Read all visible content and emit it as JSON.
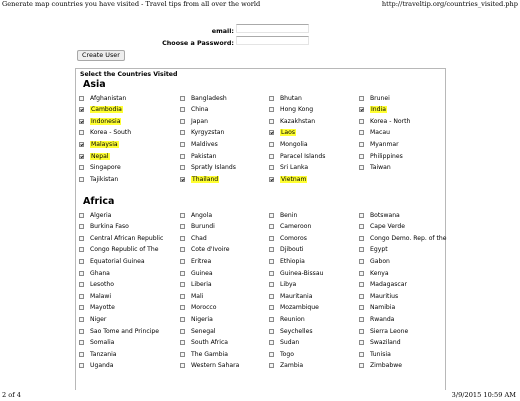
{
  "print_header": {
    "title": "Generate map countries you have visited - Travel tips from all over the world",
    "url": "http://traveltip.org/countries_visited.php"
  },
  "print_footer": {
    "page": "2 of 4",
    "timestamp": "3/9/2015 10:59 AM"
  },
  "form": {
    "email_label": "email:",
    "password_label": "Choose a Password:",
    "email_value": "",
    "password_value": "",
    "create_button": "Create User"
  },
  "countries": {
    "title": "Select the Countries Visited",
    "highlight_color": "#ffff33",
    "regions": [
      {
        "name": "Asia",
        "rows": [
          [
            {
              "name": "Afghanistan",
              "checked": false
            },
            {
              "name": "Bangladesh",
              "checked": false
            },
            {
              "name": "Bhutan",
              "checked": false
            },
            {
              "name": "Brunei",
              "checked": false
            }
          ],
          [
            {
              "name": "Cambodia",
              "checked": true
            },
            {
              "name": "China",
              "checked": false
            },
            {
              "name": "Hong Kong",
              "checked": false
            },
            {
              "name": "India",
              "checked": true
            }
          ],
          [
            {
              "name": "Indonesia",
              "checked": true
            },
            {
              "name": "Japan",
              "checked": false
            },
            {
              "name": "Kazakhstan",
              "checked": false
            },
            {
              "name": "Korea - North",
              "checked": false
            }
          ],
          [
            {
              "name": "Korea - South",
              "checked": false
            },
            {
              "name": "Kyrgyzstan",
              "checked": false
            },
            {
              "name": "Laos",
              "checked": true
            },
            {
              "name": "Macau",
              "checked": false
            }
          ],
          [
            {
              "name": "Malaysia",
              "checked": true
            },
            {
              "name": "Maldives",
              "checked": false
            },
            {
              "name": "Mongolia",
              "checked": false
            },
            {
              "name": "Myanmar",
              "checked": false
            }
          ],
          [
            {
              "name": "Nepal",
              "checked": true
            },
            {
              "name": "Pakistan",
              "checked": false
            },
            {
              "name": "Paracel Islands",
              "checked": false
            },
            {
              "name": "Philippines",
              "checked": false
            }
          ],
          [
            {
              "name": "Singapore",
              "checked": false
            },
            {
              "name": "Spratly Islands",
              "checked": false
            },
            {
              "name": "Sri Lanka",
              "checked": false
            },
            {
              "name": "Taiwan",
              "checked": false
            }
          ],
          [
            {
              "name": "Tajikistan",
              "checked": false
            },
            {
              "name": "Thailand",
              "checked": true
            },
            {
              "name": "Vietnam",
              "checked": true
            }
          ]
        ]
      },
      {
        "name": "Africa",
        "rows": [
          [
            {
              "name": "Algeria",
              "checked": false
            },
            {
              "name": "Angola",
              "checked": false
            },
            {
              "name": "Benin",
              "checked": false
            },
            {
              "name": "Botswana",
              "checked": false
            }
          ],
          [
            {
              "name": "Burkina Faso",
              "checked": false
            },
            {
              "name": "Burundi",
              "checked": false
            },
            {
              "name": "Cameroon",
              "checked": false
            },
            {
              "name": "Cape Verde",
              "checked": false
            }
          ],
          [
            {
              "name": "Central African Republic",
              "checked": false
            },
            {
              "name": "Chad",
              "checked": false
            },
            {
              "name": "Comoros",
              "checked": false
            },
            {
              "name": "Congo Demo. Rep. of the",
              "checked": false
            }
          ],
          [
            {
              "name": "Congo Republic of The",
              "checked": false
            },
            {
              "name": "Cote d'Ivoire",
              "checked": false
            },
            {
              "name": "Djibouti",
              "checked": false
            },
            {
              "name": "Egypt",
              "checked": false
            }
          ],
          [
            {
              "name": "Equatorial Guinea",
              "checked": false
            },
            {
              "name": "Eritrea",
              "checked": false
            },
            {
              "name": "Ethiopia",
              "checked": false
            },
            {
              "name": "Gabon",
              "checked": false
            }
          ],
          [
            {
              "name": "Ghana",
              "checked": false
            },
            {
              "name": "Guinea",
              "checked": false
            },
            {
              "name": "Guinea-Bissau",
              "checked": false
            },
            {
              "name": "Kenya",
              "checked": false
            }
          ],
          [
            {
              "name": "Lesotho",
              "checked": false
            },
            {
              "name": "Liberia",
              "checked": false
            },
            {
              "name": "Libya",
              "checked": false
            },
            {
              "name": "Madagascar",
              "checked": false
            }
          ],
          [
            {
              "name": "Malawi",
              "checked": false
            },
            {
              "name": "Mali",
              "checked": false
            },
            {
              "name": "Mauritania",
              "checked": false
            },
            {
              "name": "Mauritius",
              "checked": false
            }
          ],
          [
            {
              "name": "Mayotte",
              "checked": false
            },
            {
              "name": "Morocco",
              "checked": false
            },
            {
              "name": "Mozambique",
              "checked": false
            },
            {
              "name": "Namibia",
              "checked": false
            }
          ],
          [
            {
              "name": "Niger",
              "checked": false
            },
            {
              "name": "Nigeria",
              "checked": false
            },
            {
              "name": "Reunion",
              "checked": false
            },
            {
              "name": "Rwanda",
              "checked": false
            }
          ],
          [
            {
              "name": "Sao Tome and Principe",
              "checked": false
            },
            {
              "name": "Senegal",
              "checked": false
            },
            {
              "name": "Seychelles",
              "checked": false
            },
            {
              "name": "Sierra Leone",
              "checked": false
            }
          ],
          [
            {
              "name": "Somalia",
              "checked": false
            },
            {
              "name": "South Africa",
              "checked": false
            },
            {
              "name": "Sudan",
              "checked": false
            },
            {
              "name": "Swaziland",
              "checked": false
            }
          ],
          [
            {
              "name": "Tanzania",
              "checked": false
            },
            {
              "name": "The Gambia",
              "checked": false
            },
            {
              "name": "Togo",
              "checked": false
            },
            {
              "name": "Tunisia",
              "checked": false
            }
          ],
          [
            {
              "name": "Uganda",
              "checked": false
            },
            {
              "name": "Western Sahara",
              "checked": false
            },
            {
              "name": "Zambia",
              "checked": false
            },
            {
              "name": "Zimbabwe",
              "checked": false
            }
          ]
        ]
      }
    ]
  }
}
